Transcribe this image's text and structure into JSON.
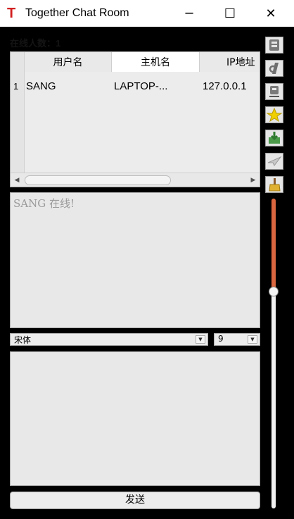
{
  "window": {
    "title": "Together Chat Room",
    "icon": "T",
    "controls": {
      "minimize": "─",
      "maximize": "☐",
      "close": "✕"
    }
  },
  "online_label": "在线人数：1",
  "user_table": {
    "columns": [
      "用户名",
      "主机名",
      "IP地址"
    ],
    "rows": [
      {
        "index": "1",
        "username": "SANG",
        "hostname": "LAPTOP-...",
        "ip": "127.0.0.1"
      }
    ]
  },
  "messages": [
    "SANG 在线!"
  ],
  "font_select": {
    "value": "宋体"
  },
  "size_select": {
    "value": "9"
  },
  "input_text": "",
  "send_label": "发送",
  "toolbar": [
    {
      "icon": "bold-icon"
    },
    {
      "icon": "italic-icon"
    },
    {
      "icon": "underline-icon"
    },
    {
      "icon": "color-icon"
    },
    {
      "icon": "save-icon"
    },
    {
      "icon": "send-file-icon"
    },
    {
      "icon": "clear-icon"
    }
  ],
  "volume_slider": {
    "value_percent": 70
  },
  "colors": {
    "accent": "#d9663e",
    "app_icon": "#d21f1f",
    "background": "#000000",
    "panel": "#e8e8e8"
  }
}
